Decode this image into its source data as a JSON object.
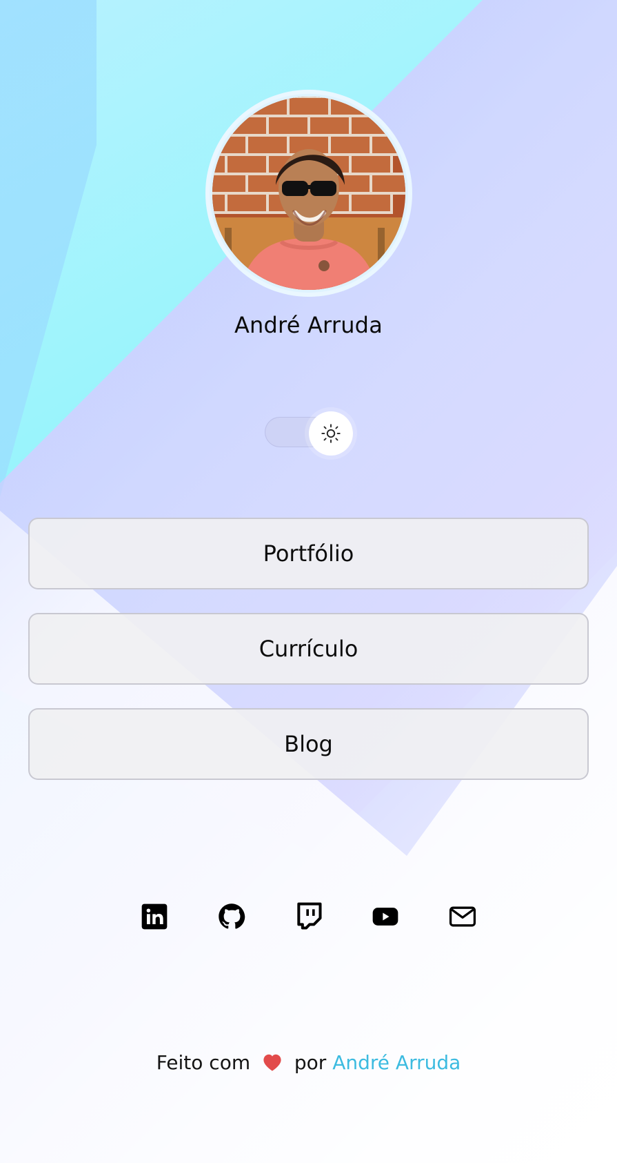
{
  "profile": {
    "name": "André Arruda"
  },
  "theme_toggle": {
    "icon": "sun-icon"
  },
  "links": {
    "portfolio": "Portfólio",
    "curriculum": "Currículo",
    "blog": "Blog"
  },
  "socials": [
    {
      "name": "linkedin-icon"
    },
    {
      "name": "github-icon"
    },
    {
      "name": "twitch-icon"
    },
    {
      "name": "youtube-icon"
    },
    {
      "name": "mail-icon"
    }
  ],
  "footer": {
    "made_with": "Feito com",
    "by": "por",
    "author": "André Arruda"
  },
  "colors": {
    "accent": "#3cbbe0"
  }
}
